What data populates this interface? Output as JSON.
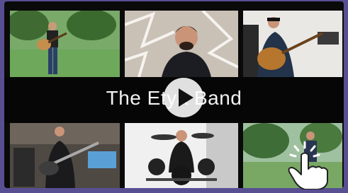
{
  "video": {
    "title": "The Etya Band"
  },
  "icons": {
    "play": "play-icon",
    "cursor": "hand-pointer-icon"
  },
  "colors": {
    "frame": "#584f93",
    "band": "#060606",
    "title_text": "#f2f2f2"
  }
}
